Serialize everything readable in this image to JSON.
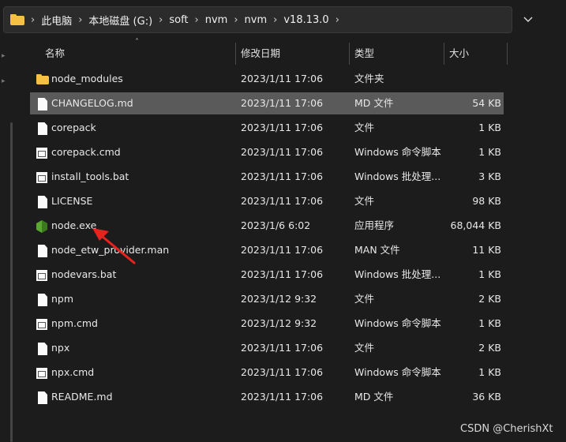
{
  "address": {
    "crumbs": [
      "此电脑",
      "本地磁盘 (G:)",
      "soft",
      "nvm",
      "nvm",
      "v18.13.0"
    ],
    "separator": "›",
    "dropdown_icon": "chevron-down-icon"
  },
  "columns": {
    "name": "名称",
    "date": "修改日期",
    "type": "类型",
    "size": "大小"
  },
  "files": [
    {
      "name": "node_modules",
      "date": "2023/1/11 17:06",
      "type": "文件夹",
      "size": "",
      "icon": "folder"
    },
    {
      "name": "CHANGELOG.md",
      "date": "2023/1/11 17:06",
      "type": "MD 文件",
      "size": "54 KB",
      "icon": "doc",
      "selected": true
    },
    {
      "name": "corepack",
      "date": "2023/1/11 17:06",
      "type": "文件",
      "size": "1 KB",
      "icon": "doc"
    },
    {
      "name": "corepack.cmd",
      "date": "2023/1/11 17:06",
      "type": "Windows 命令脚本",
      "size": "1 KB",
      "icon": "script"
    },
    {
      "name": "install_tools.bat",
      "date": "2023/1/11 17:06",
      "type": "Windows 批处理...",
      "size": "3 KB",
      "icon": "script"
    },
    {
      "name": "LICENSE",
      "date": "2023/1/11 17:06",
      "type": "文件",
      "size": "98 KB",
      "icon": "doc"
    },
    {
      "name": "node.exe",
      "date": "2023/1/6 6:02",
      "type": "应用程序",
      "size": "68,044 KB",
      "icon": "exe"
    },
    {
      "name": "node_etw_provider.man",
      "date": "2023/1/11 17:06",
      "type": "MAN 文件",
      "size": "11 KB",
      "icon": "doc"
    },
    {
      "name": "nodevars.bat",
      "date": "2023/1/11 17:06",
      "type": "Windows 批处理...",
      "size": "1 KB",
      "icon": "script"
    },
    {
      "name": "npm",
      "date": "2023/1/12 9:32",
      "type": "文件",
      "size": "2 KB",
      "icon": "doc"
    },
    {
      "name": "npm.cmd",
      "date": "2023/1/12 9:32",
      "type": "Windows 命令脚本",
      "size": "1 KB",
      "icon": "script"
    },
    {
      "name": "npx",
      "date": "2023/1/11 17:06",
      "type": "文件",
      "size": "2 KB",
      "icon": "doc"
    },
    {
      "name": "npx.cmd",
      "date": "2023/1/11 17:06",
      "type": "Windows 命令脚本",
      "size": "1 KB",
      "icon": "script"
    },
    {
      "name": "README.md",
      "date": "2023/1/11 17:06",
      "type": "MD 文件",
      "size": "36 KB",
      "icon": "doc"
    }
  ],
  "annotation_color": "#e8231e",
  "watermark": "CSDN @CherishXt"
}
